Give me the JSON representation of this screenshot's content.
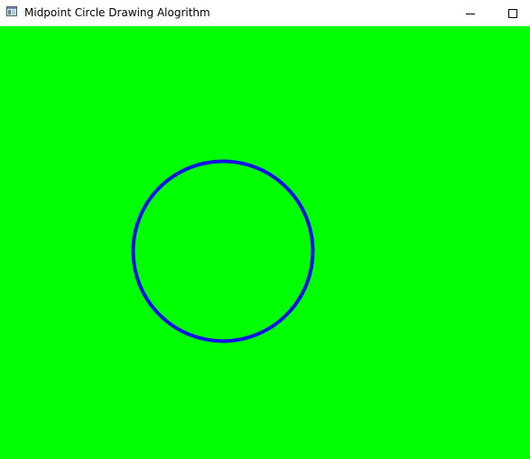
{
  "window": {
    "title": "Midpoint Circle Drawing Alogrithm",
    "app_icon": "app-window-icon",
    "controls": [
      {
        "name": "minimize",
        "icon": "minimize-icon"
      },
      {
        "name": "maximize",
        "icon": "maximize-icon"
      }
    ]
  },
  "canvas": {
    "background_color": "#00ff00",
    "shape": {
      "type": "circle",
      "stroke_color": "#1010e8",
      "fill": "none"
    }
  }
}
